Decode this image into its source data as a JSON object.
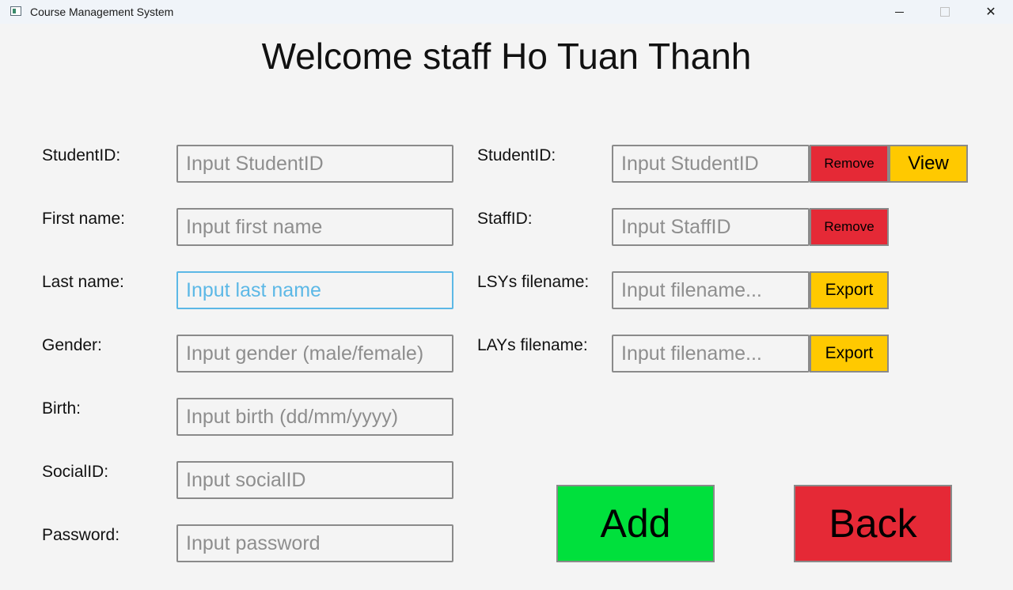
{
  "window": {
    "title": "Course Management System",
    "controls": {
      "minimize": "",
      "maximize": "",
      "close": "✕"
    }
  },
  "heading": "Welcome staff Ho Tuan Thanh",
  "student_form": {
    "student_id": {
      "label": "StudentID:",
      "placeholder": "Input StudentID"
    },
    "first_name": {
      "label": "First name:",
      "placeholder": "Input first name"
    },
    "last_name": {
      "label": "Last name:",
      "placeholder": "Input last name"
    },
    "gender": {
      "label": "Gender:",
      "placeholder": "Input gender (male/female)"
    },
    "birth": {
      "label": "Birth:",
      "placeholder": "Input birth (dd/mm/yyyy)"
    },
    "social_id": {
      "label": "SocialID:",
      "placeholder": "Input socialID"
    },
    "password": {
      "label": "Password:",
      "placeholder": "Input password"
    }
  },
  "manage": {
    "student_id": {
      "label": "StudentID:",
      "placeholder": "Input StudentID",
      "remove_label": "Remove",
      "view_label": "View"
    },
    "staff_id": {
      "label": "StaffID:",
      "placeholder": "Input StaffID",
      "remove_label": "Remove"
    },
    "lsys_filename": {
      "label": "LSYs filename:",
      "placeholder": "Input filename...",
      "export_label": "Export"
    },
    "lays_filename": {
      "label": "LAYs filename:",
      "placeholder": "Input filename...",
      "export_label": "Export"
    }
  },
  "actions": {
    "add_label": "Add",
    "back_label": "Back"
  },
  "colors": {
    "remove": "#e52936",
    "view_export": "#ffc900",
    "add": "#00e03c",
    "back": "#e52936",
    "focus": "#5cb8e6"
  }
}
